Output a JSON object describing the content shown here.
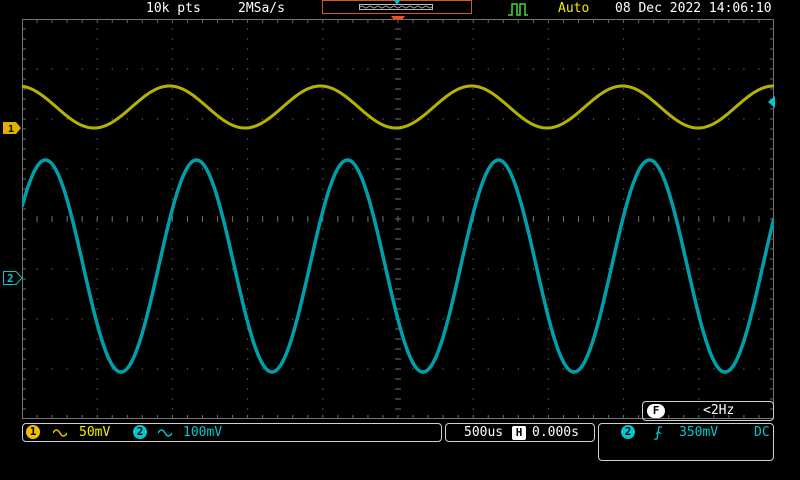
{
  "header": {
    "points": "10k pts",
    "sample_rate": "2MSa/s",
    "trigger_mode": "Auto",
    "datetime": "08 Dec 2022 14:06:10"
  },
  "channels": [
    {
      "id": "1",
      "color": "#c8c800",
      "coupling_icon": "ac-wave-icon",
      "scale": "50mV"
    },
    {
      "id": "2",
      "color": "#00c8d2",
      "coupling_icon": "ac-wave-icon",
      "scale": "100mV"
    }
  ],
  "timebase": {
    "scale": "500us",
    "position_icon": "H",
    "position": "0.000s"
  },
  "trigger": {
    "source": "2",
    "slope_icon": "rising-edge-icon",
    "level": "350mV",
    "coupling": "DC"
  },
  "frequency": {
    "label": "F",
    "value": "<2Hz"
  },
  "colors": {
    "ch1": "#b4b400",
    "ch2": "#00a0aa",
    "trigger_marker": "#ff4a1a",
    "grid": "#6a6a6a"
  }
}
